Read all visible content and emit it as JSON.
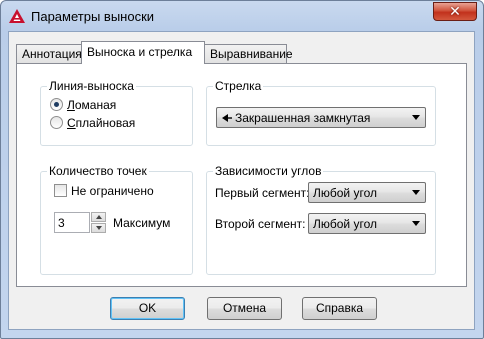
{
  "window": {
    "title": "Параметры выноски",
    "close_glyph": "✕",
    "app_icon": "autocad-logo-icon",
    "accent": "#c2311c"
  },
  "tabs": [
    {
      "label": "Аннотация",
      "active": false
    },
    {
      "label": "Выноска и стрелка",
      "active": true
    },
    {
      "label": "Выравнивание",
      "active": false
    }
  ],
  "leader_line": {
    "title": "Линия-выноска",
    "options": [
      {
        "label": "Ломаная",
        "accel": "Л",
        "rest": "оманая",
        "selected": true
      },
      {
        "label": "Сплайновая",
        "accel": "С",
        "rest": "плайновая",
        "selected": false
      }
    ]
  },
  "arrow": {
    "title": "Стрелка",
    "selected": "Закрашенная замкнутая",
    "icon": "filled-closed-arrow-icon"
  },
  "points": {
    "title": "Количество точек",
    "unlimited_label": "Не ограничено",
    "unlimited_checked": false,
    "value": "3",
    "max_label": "Максимум"
  },
  "angles": {
    "title": "Зависимости углов",
    "first_label": "Первый сегмент:",
    "first_value": "Любой угол",
    "second_label": "Второй сегмент:",
    "second_value": "Любой угол"
  },
  "buttons": {
    "ok": "OK",
    "cancel": "Отмена",
    "help": "Справка"
  }
}
